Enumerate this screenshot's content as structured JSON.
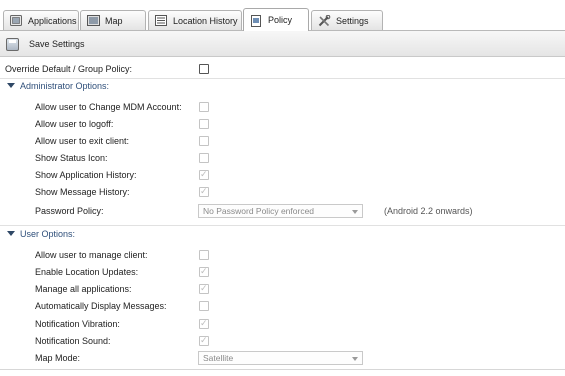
{
  "tabs": [
    {
      "label": "Applications",
      "icon": "applications-icon"
    },
    {
      "label": "Map",
      "icon": "map-icon"
    },
    {
      "label": "Location History",
      "icon": "location-history-icon"
    },
    {
      "label": "Policy",
      "icon": "policy-icon",
      "active": true
    },
    {
      "label": "Settings",
      "icon": "settings-tools-icon"
    }
  ],
  "toolbar": {
    "save_label": "Save Settings"
  },
  "override": {
    "label": "Override Default / Group Policy:",
    "checked": false
  },
  "admin": {
    "title": "Administrator Options:",
    "items": [
      {
        "label": "Allow user to Change MDM Account:",
        "checked": false
      },
      {
        "label": "Allow user to logoff:",
        "checked": false
      },
      {
        "label": "Allow user to exit client:",
        "checked": false
      },
      {
        "label": "Show Status Icon:",
        "checked": false
      },
      {
        "label": "Show Application History:",
        "checked": true
      },
      {
        "label": "Show Message History:",
        "checked": true
      }
    ],
    "password": {
      "label": "Password Policy:",
      "value": "No Password Policy enforced",
      "note": "(Android 2.2 onwards)"
    }
  },
  "user": {
    "title": "User Options:",
    "items": [
      {
        "label": "Allow user to manage client:",
        "checked": false
      },
      {
        "label": "Enable Location Updates:",
        "checked": true
      },
      {
        "label": "Manage all applications:",
        "checked": true
      },
      {
        "label": "Automatically Display Messages:",
        "checked": false
      },
      {
        "label": "Notification Vibration:",
        "checked": true
      },
      {
        "label": "Notification Sound:",
        "checked": true
      }
    ],
    "map_mode": {
      "label": "Map Mode:",
      "value": "Satellite"
    }
  }
}
